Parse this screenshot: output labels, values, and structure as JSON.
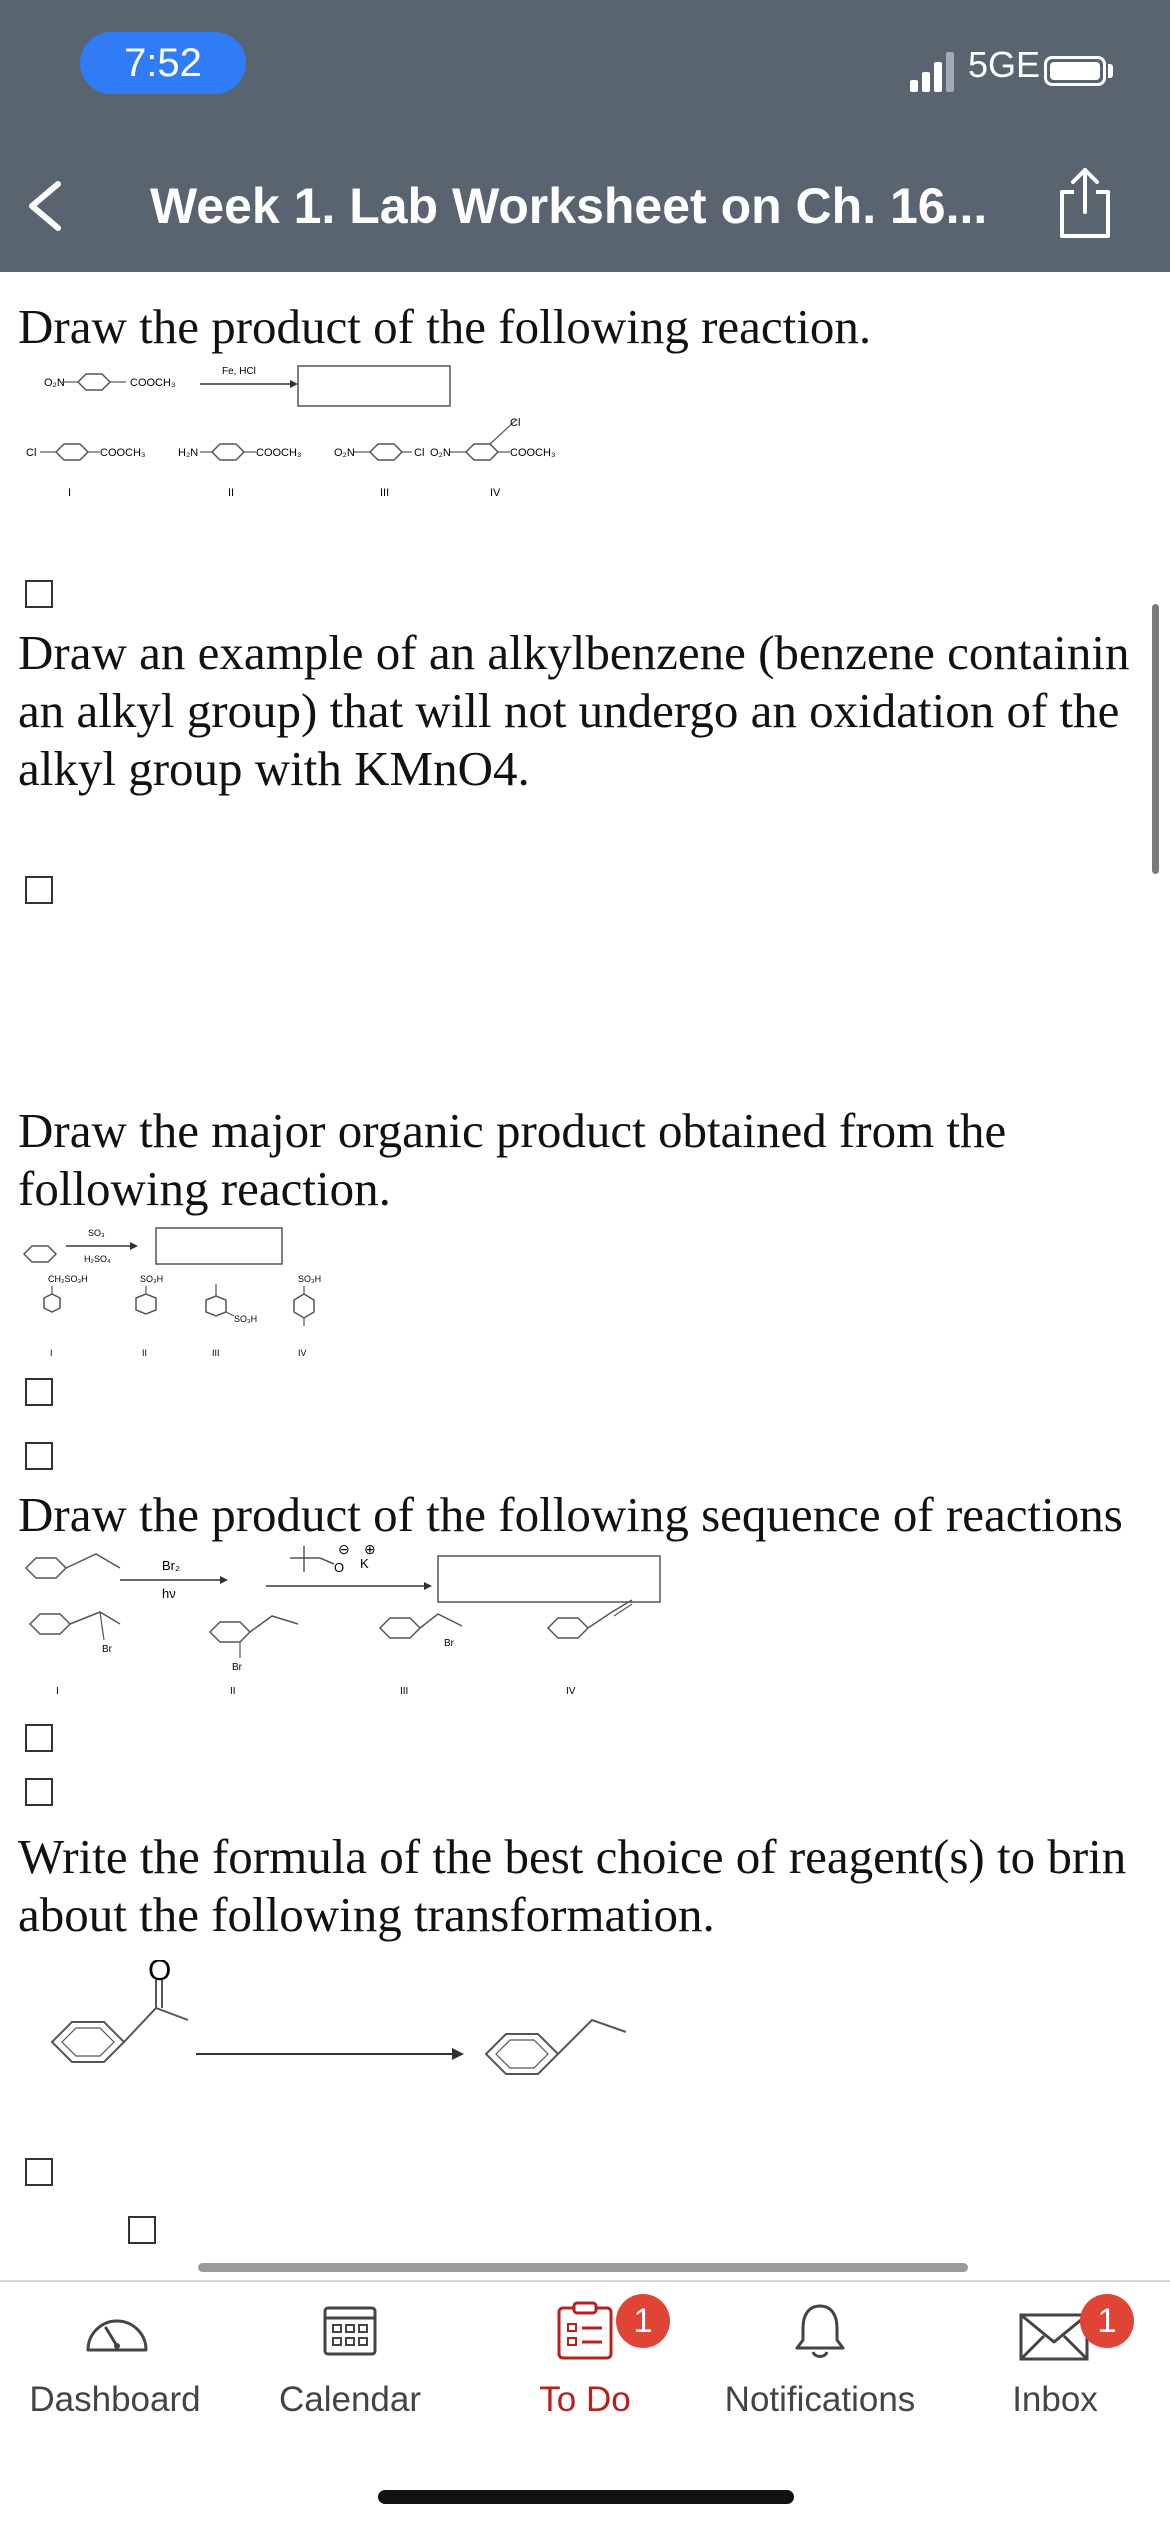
{
  "status_bar": {
    "time": "7:52",
    "network": "5GE"
  },
  "header": {
    "title": "Week 1. Lab Worksheet on Ch. 16..."
  },
  "questions": [
    {
      "lines": [
        "Draw the product of the following reaction."
      ],
      "reaction": {
        "reactant_left": "O₂N",
        "reactant_right": "COOCH₃",
        "reagent": "Fe, HCl"
      },
      "choices": [
        {
          "roman": "I",
          "left": "Cl",
          "right": "COOCH₃",
          "top": ""
        },
        {
          "roman": "II",
          "left": "H₂N",
          "right": "COOCH₃",
          "top": ""
        },
        {
          "roman": "III",
          "left": "O₂N",
          "right": "Cl",
          "top": ""
        },
        {
          "roman": "IV",
          "left": "O₂N",
          "right": "COOCH₃",
          "top": "Cl"
        }
      ]
    },
    {
      "lines": [
        "Draw an example of an alkylbenzene (benzene containin",
        "an alkyl group) that will not undergo an oxidation of the",
        "alkyl group with KMnO4."
      ]
    },
    {
      "lines": [
        "Draw the major organic product obtained from the",
        "following reaction."
      ],
      "reaction": {
        "reagent_top": "SO₃",
        "reagent_bottom": "H₂SO₄"
      },
      "choices": [
        {
          "roman": "I",
          "label": "CH₂SO₃H"
        },
        {
          "roman": "II",
          "label": "SO₃H"
        },
        {
          "roman": "III",
          "label": "SO₃H"
        },
        {
          "roman": "IV",
          "label": "SO₃H"
        }
      ]
    },
    {
      "lines": [
        "Draw the product of the following sequence of reactions"
      ],
      "reaction": {
        "reagent1_top": "Br₂",
        "reagent1_bottom": "hν",
        "reagent2": "O",
        "charge_minus": "⊖",
        "charge_plus": "⊕",
        "counterion": "K"
      },
      "choices": [
        {
          "roman": "I",
          "label": "Br"
        },
        {
          "roman": "II",
          "label": "Br"
        },
        {
          "roman": "III",
          "label": "Br"
        },
        {
          "roman": "IV",
          "label": ""
        }
      ]
    },
    {
      "lines": [
        "Write the formula of the best choice of reagent(s) to brin",
        "about the following transformation."
      ],
      "reaction": {
        "carbonyl_o": "O"
      }
    }
  ],
  "nav": [
    {
      "label": "Dashboard",
      "icon": "dashboard-gauge-icon"
    },
    {
      "label": "Calendar",
      "icon": "calendar-icon"
    },
    {
      "label": "To Do",
      "icon": "todo-clipboard-icon",
      "badge": "1"
    },
    {
      "label": "Notifications",
      "icon": "bell-icon"
    },
    {
      "label": "Inbox",
      "icon": "envelope-icon",
      "badge": "1"
    }
  ],
  "colors": {
    "header": "#5a6470",
    "time_pill": "#2f7cf6",
    "active_tab": "#b8201c",
    "badge": "#e04436"
  }
}
